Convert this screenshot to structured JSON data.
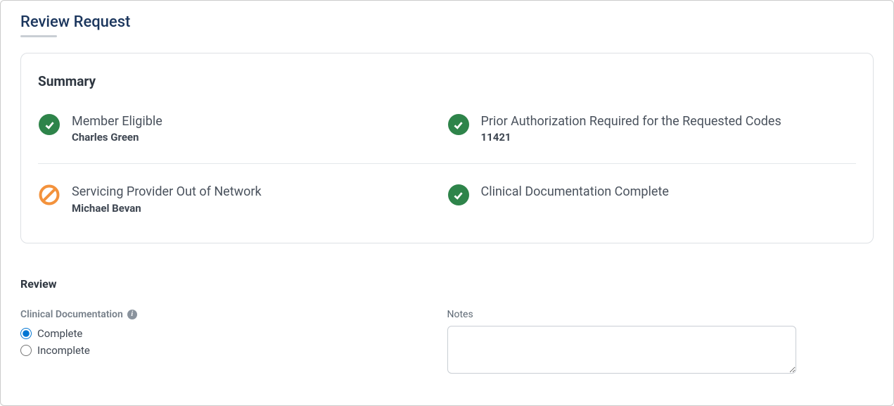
{
  "page": {
    "title": "Review Request"
  },
  "summary": {
    "heading": "Summary",
    "items": [
      {
        "icon": "check",
        "title": "Member Eligible",
        "subtitle": "Charles Green"
      },
      {
        "icon": "check",
        "title": "Prior Authorization Required for the Requested Codes",
        "subtitle": "11421"
      },
      {
        "icon": "blocked",
        "title": "Servicing Provider Out of Network",
        "subtitle": "Michael Bevan"
      },
      {
        "icon": "check",
        "title": "Clinical Documentation Complete",
        "subtitle": ""
      }
    ]
  },
  "review": {
    "heading": "Review",
    "clinical_doc": {
      "label": "Clinical Documentation",
      "options": {
        "complete": "Complete",
        "incomplete": "Incomplete"
      },
      "selected": "complete"
    },
    "notes": {
      "label": "Notes",
      "value": ""
    }
  }
}
